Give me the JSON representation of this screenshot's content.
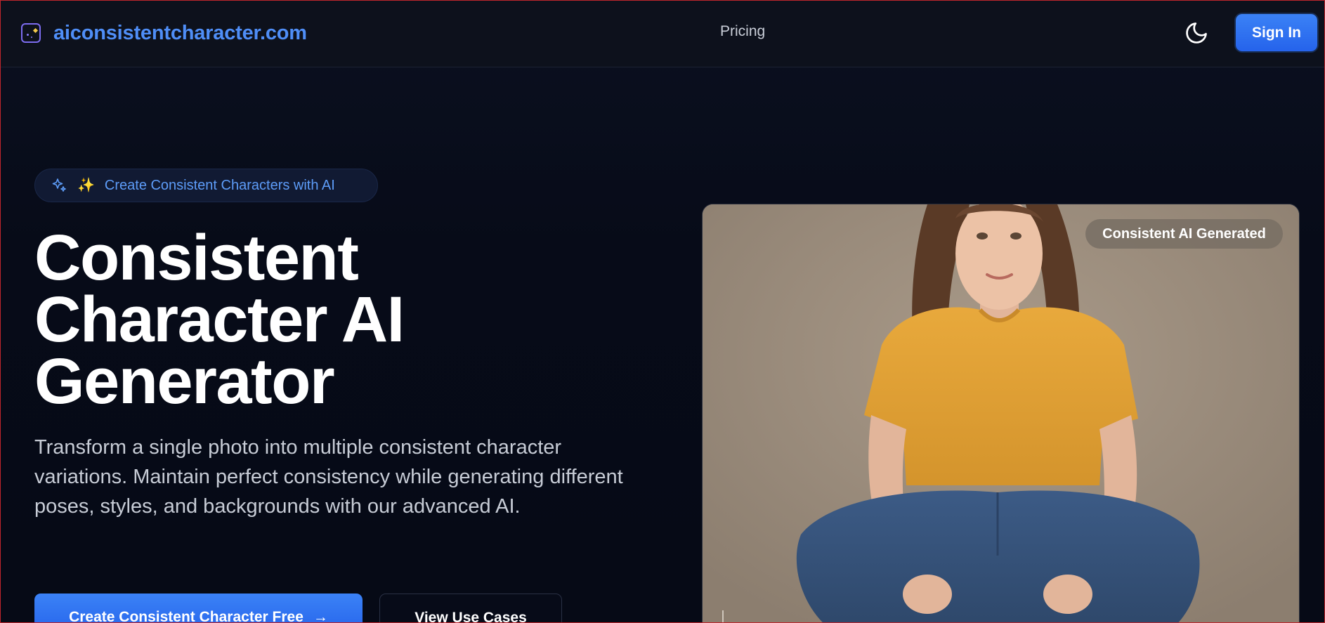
{
  "header": {
    "brand": "aiconsistentcharacter.com",
    "nav_pricing": "Pricing",
    "sign_in": "Sign In"
  },
  "hero": {
    "badge_emoji": "✨",
    "badge_text": "Create Consistent Characters with AI",
    "title_line1": "Consistent",
    "title_line2": "Character AI",
    "title_line3": "Generator",
    "description": "Transform a single photo into multiple consistent character variations. Maintain perfect consistency while generating different poses, styles, and backgrounds with our advanced AI.",
    "primary_button": "Create Consistent Character Free",
    "primary_button_icon": "→",
    "secondary_button": "View Use Cases",
    "image_tag": "Consistent AI Generated"
  },
  "colors": {
    "background": "#070b18",
    "header_bg": "#0d111c",
    "brand": "#4f8ef7",
    "accent": "#3b82f6",
    "badge_text": "#5d9cf8"
  },
  "icons": {
    "brand": "sparkle-frame-icon",
    "theme": "moon-icon",
    "badge": "sparkles-icon",
    "arrow": "arrow-right-icon"
  }
}
